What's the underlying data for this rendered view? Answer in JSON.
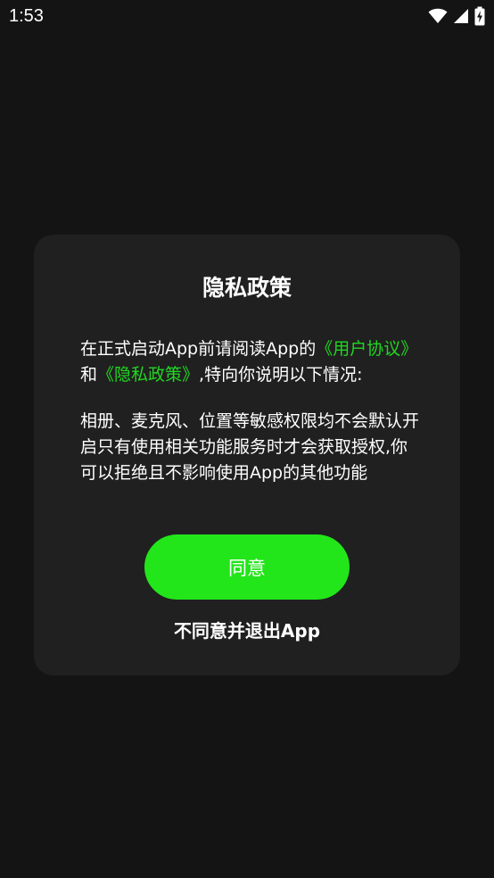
{
  "status_bar": {
    "time": "1:53",
    "icons": [
      "wifi-icon",
      "cell-signal-icon",
      "battery-charging-icon"
    ]
  },
  "dialog": {
    "title": "隐私政策",
    "paragraph1": {
      "prefix": "在正式启动App前请阅读App的",
      "link_user_agreement": "《用户协议》",
      "conjunction": "和",
      "link_privacy_policy": "《隐私政策》",
      "suffix": ",特向你说明以下情况:"
    },
    "paragraph2": "相册、麦克风、位置等敏感权限均不会默认开启只有使用相关功能服务时才会获取授权,你可以拒绝且不影响使用App的其他功能",
    "agree_label": "同意",
    "decline_label": "不同意并退出App"
  },
  "colors": {
    "background": "#141414",
    "dialog_bg": "#202020",
    "accent_green": "#22e61a",
    "link_green": "#22d622"
  }
}
